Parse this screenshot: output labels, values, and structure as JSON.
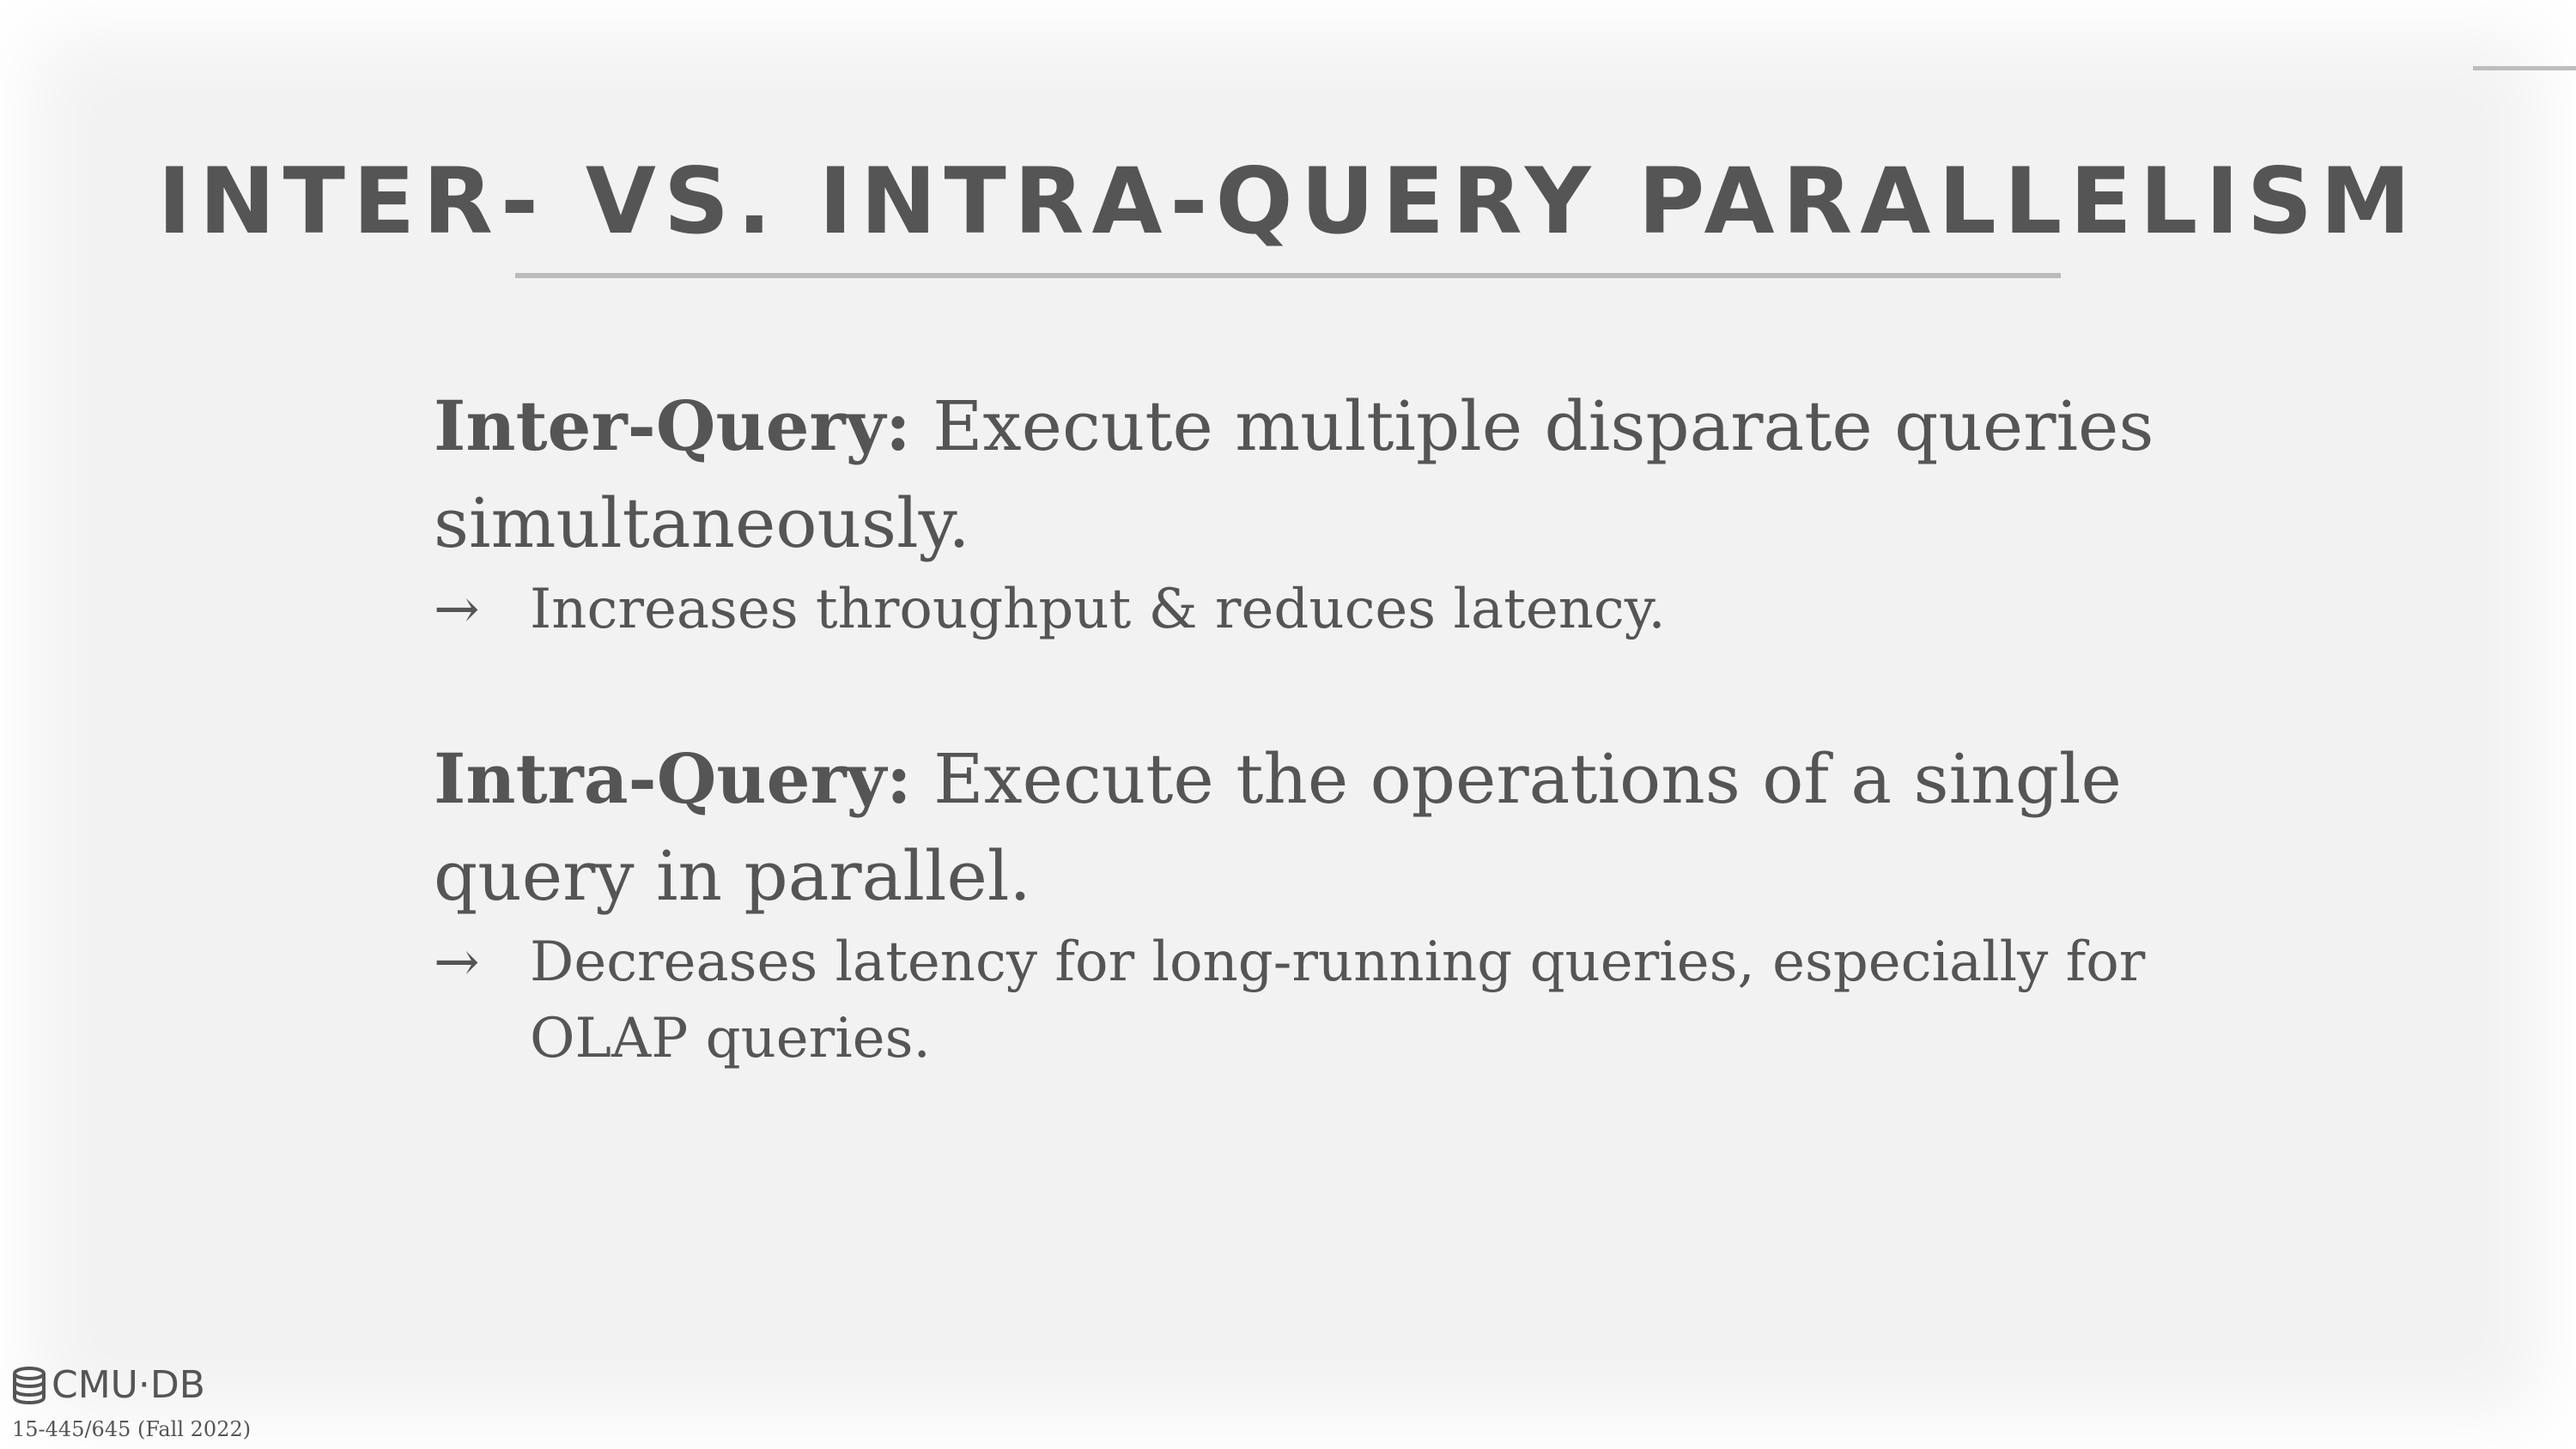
{
  "slide": {
    "title": "INTER- VS. INTRA-QUERY PARALLELISM",
    "points": [
      {
        "term": "Inter-Query:",
        "text": "Execute multiple disparate queries simultaneously.",
        "sub_arrow": "→",
        "sub_text": "Increases throughput & reduces latency."
      },
      {
        "term": "Intra-Query:",
        "text": "Execute the operations of a single query in parallel.",
        "sub_arrow": "→",
        "sub_text": "Decreases latency for long-running queries, especially for OLAP queries."
      }
    ]
  },
  "footer": {
    "logo_text": "CMU·DB",
    "logo_icon": "database-icon",
    "course": "15-445/645 (Fall 2022)"
  },
  "colors": {
    "text": "#555555",
    "background": "#f2f2f2",
    "rule": "#bbbbbb"
  }
}
